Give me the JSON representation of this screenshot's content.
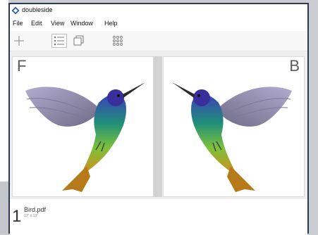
{
  "window": {
    "title": "doubleside"
  },
  "menu": [
    "File",
    "Edit",
    "View",
    "Window",
    "Help"
  ],
  "toolbar": {
    "buttons": [
      {
        "icon": "plus-icon"
      },
      {
        "icon": "list-icon"
      },
      {
        "icon": "copy-pages-icon"
      },
      {
        "icon": "grid-dots-icon"
      }
    ]
  },
  "canvas": {
    "front_label": "F",
    "back_label": "B"
  },
  "file": {
    "index": "1",
    "name": "Bird.pdf",
    "size": "13\" x 13\""
  },
  "colors": {
    "window_border": "#2c3a57",
    "canvas_bg": "#efefef",
    "spine": "#d3d3d3"
  }
}
